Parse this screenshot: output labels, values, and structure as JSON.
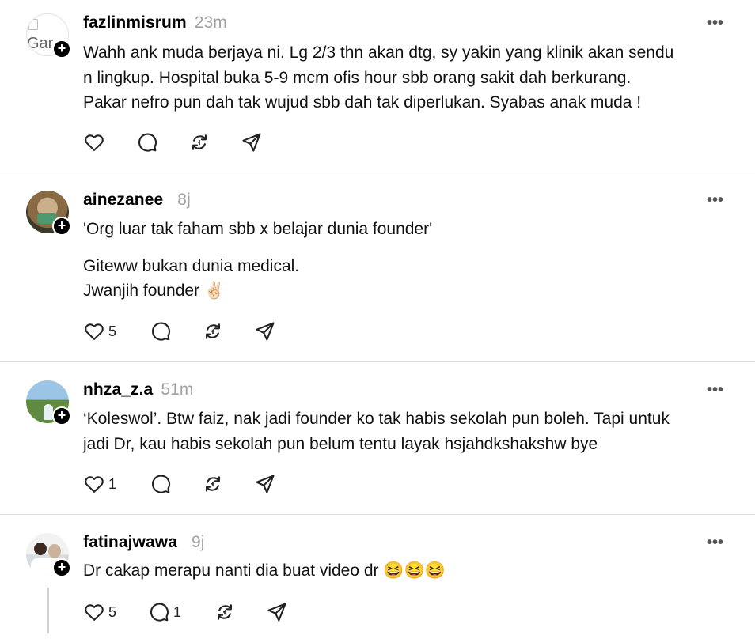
{
  "posts": [
    {
      "username": "fazlinmisrum",
      "time": "23m",
      "avatar_alt": "Gar",
      "lines": [
        "Wahh ank muda berjaya ni. Lg 2/3 thn akan dtg, sy yakin yang klinik akan sendu",
        "n lingkup. Hospital buka 5-9 mcm ofis hour sbb orang sakit dah berkurang.",
        "Pakar nefro pun dah tak wujud sbb dah tak diperlukan. Syabas anak muda !"
      ],
      "likes": "",
      "replies": ""
    },
    {
      "username": "ainezanee",
      "time": "8j",
      "lines": [
        "'Org luar tak faham sbb x belajar dunia founder'",
        "",
        "Giteww bukan dunia medical.",
        "Jwanjih founder ✌🏻"
      ],
      "likes": "5",
      "replies": ""
    },
    {
      "username": "nhza_z.a",
      "time": "51m",
      "lines": [
        "‘Koleswol’. Btw faiz, nak jadi founder ko tak habis sekolah pun boleh. Tapi untuk",
        "jadi Dr, kau habis sekolah pun belum tentu layak hsjahdkshakshw bye"
      ],
      "likes": "1",
      "replies": ""
    },
    {
      "username": "fatinajwawa",
      "time": "9j",
      "lines": [
        "Dr cakap merapu nanti dia buat video dr 😆😆😆"
      ],
      "likes": "5",
      "replies": "1"
    }
  ],
  "more_symbol": "•••",
  "follow_symbol": "+",
  "icons": [
    "heart-icon",
    "reply-icon",
    "repost-icon",
    "share-icon",
    "more-icon",
    "follow-plus-icon"
  ]
}
